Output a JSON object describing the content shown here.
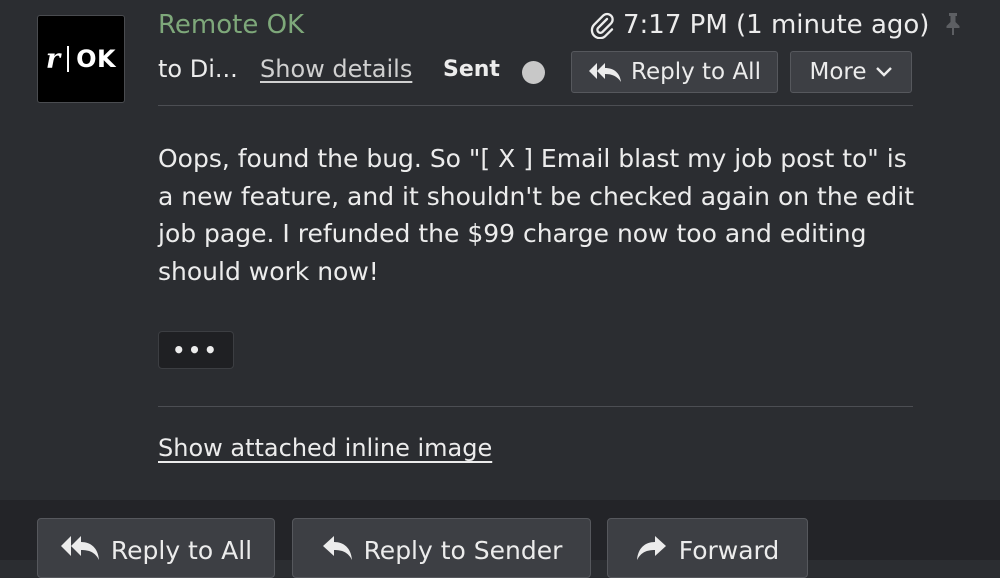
{
  "email": {
    "avatar": {
      "logo_left": "r",
      "logo_right": "OK"
    },
    "sender": "Remote OK",
    "timestamp": "7:17 PM (1 minute ago)",
    "to": "to Di...",
    "show_details": "Show details",
    "status": "Sent",
    "actions": {
      "reply_all": "Reply to All",
      "more": "More"
    },
    "body": "Oops, found the bug. So \"[ X ] Email blast my job post to\" is a new feature, and it shouldn't be checked again on the edit job page. I refunded the $99 charge now too and editing should work now!",
    "quoted_toggle": "•••",
    "show_inline_image": "Show attached inline image"
  },
  "footer": {
    "reply_all": "Reply to All",
    "reply_sender": "Reply to Sender",
    "forward": "Forward"
  },
  "colors": {
    "background": "#2b2d31",
    "footer_background": "#232428",
    "sender_green": "#7ea87a",
    "button_bg": "#3d3f44",
    "text": "#ececec"
  },
  "icons": [
    "paperclip-icon",
    "pin-icon",
    "reply-all-icon",
    "chevron-down-icon",
    "reply-icon",
    "forward-icon"
  ]
}
